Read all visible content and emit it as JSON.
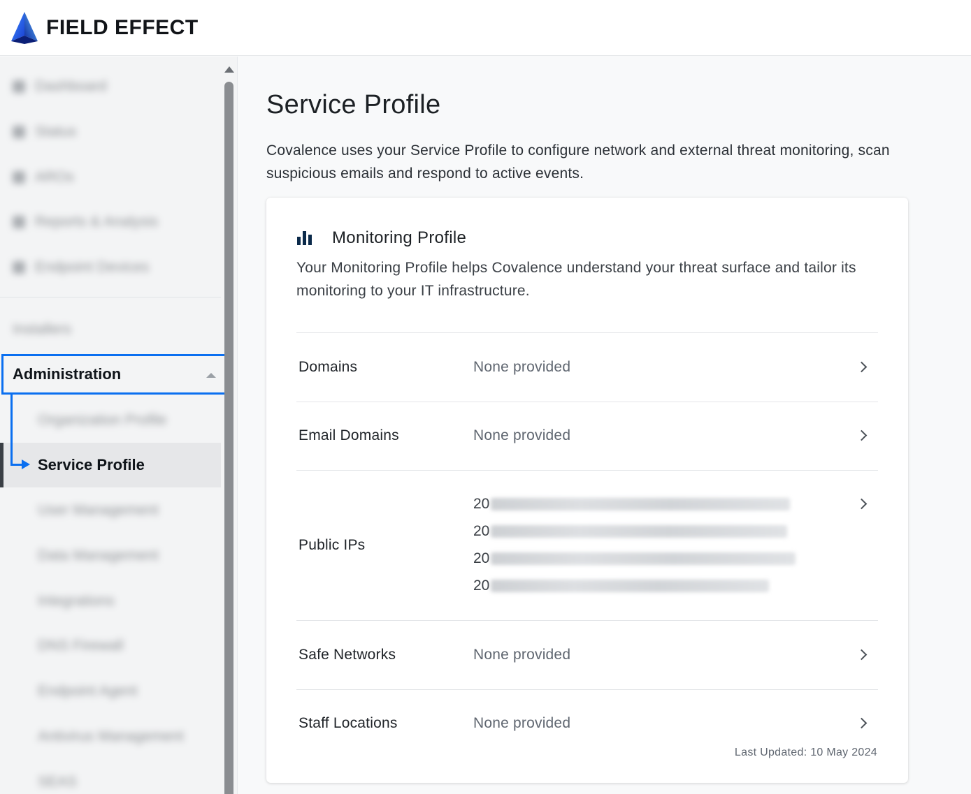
{
  "brand": {
    "name": "FIELD EFFECT",
    "accent": "#0a6ff0"
  },
  "sidebar": {
    "items": [
      {
        "label": "Dashboard",
        "icon": "dashboard-icon"
      },
      {
        "label": "Status",
        "icon": "status-icon"
      },
      {
        "label": "AROs",
        "icon": "aro-icon"
      },
      {
        "label": "Reports & Analysis",
        "icon": "reports-icon"
      },
      {
        "label": "Endpoint Devices",
        "icon": "devices-icon"
      }
    ],
    "installers_label": "Installers",
    "admin_label": "Administration",
    "admin_sub_items": [
      {
        "label": "Organization Profile"
      },
      {
        "label": "Service Profile",
        "active": true
      },
      {
        "label": "User Management"
      },
      {
        "label": "Data Management"
      },
      {
        "label": "Integrations"
      },
      {
        "label": "DNS Firewall"
      },
      {
        "label": "Endpoint Agent"
      },
      {
        "label": "Antivirus Management"
      },
      {
        "label": "SEAS"
      }
    ]
  },
  "main": {
    "title": "Service Profile",
    "description": "Covalence uses your Service Profile to configure network and external threat monitoring, scan suspicious emails and respond to active events.",
    "card": {
      "title": "Monitoring Profile",
      "icon": "bar-chart-icon",
      "description": "Your Monitoring Profile helps Covalence understand your threat surface and tailor its monitoring to your IT infrastructure.",
      "rows": [
        {
          "label": "Domains",
          "value": "None provided"
        },
        {
          "label": "Email Domains",
          "value": "None provided"
        },
        {
          "label": "Public IPs",
          "ips": [
            "20",
            "20",
            "20",
            "20"
          ]
        },
        {
          "label": "Safe Networks",
          "value": "None provided"
        },
        {
          "label": "Staff Locations",
          "value": "None provided"
        }
      ],
      "last_updated": "Last Updated: 10 May 2024"
    }
  }
}
